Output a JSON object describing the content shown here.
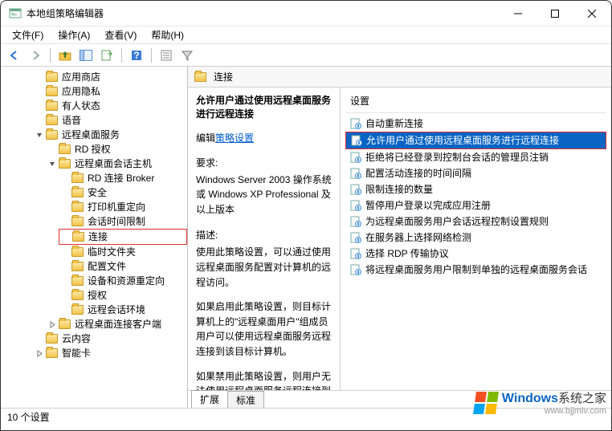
{
  "window": {
    "title": "本地组策略编辑器"
  },
  "menu": {
    "file": "文件(F)",
    "action": "操作(A)",
    "view": "查看(V)",
    "help": "帮助(H)"
  },
  "tree": {
    "items": [
      {
        "label": "应用商店",
        "twisty": ""
      },
      {
        "label": "应用隐私",
        "twisty": ""
      },
      {
        "label": "有人状态",
        "twisty": ""
      },
      {
        "label": "语音",
        "twisty": ""
      },
      {
        "label": "远程桌面服务",
        "twisty": "open",
        "children": [
          {
            "label": "RD 授权",
            "twisty": ""
          },
          {
            "label": "远程桌面会话主机",
            "twisty": "open",
            "children": [
              {
                "label": "RD 连接 Broker"
              },
              {
                "label": "安全"
              },
              {
                "label": "打印机重定向"
              },
              {
                "label": "会话时间限制"
              },
              {
                "label": "连接",
                "highlighted": true
              },
              {
                "label": "临时文件夹"
              },
              {
                "label": "配置文件"
              },
              {
                "label": "设备和资源重定向"
              },
              {
                "label": "授权"
              },
              {
                "label": "远程会话环境"
              }
            ]
          },
          {
            "label": "远程桌面连接客户端",
            "twisty": "closed"
          }
        ]
      },
      {
        "label": "云内容",
        "twisty": ""
      },
      {
        "label": "智能卡",
        "twisty": "closed"
      }
    ]
  },
  "details": {
    "header": "连接",
    "heading": "允许用户通过使用远程桌面服务进行远程连接",
    "edit_label": "编辑",
    "edit_link": "策略设置",
    "req_label": "要求:",
    "req_text": "Windows Server 2003 操作系统或 Windows XP Professional 及以上版本",
    "desc_label": "描述:",
    "desc1": "使用此策略设置，可以通过使用远程桌面服务配置对计算机的远程访问。",
    "desc2": "如果启用此策略设置，则目标计算机上的\"远程桌面用户\"组成员用户可以使用远程桌面服务远程连接到该目标计算机。",
    "desc3": "如果禁用此策略设置，则用户无法使用远程桌面服务远程连接到目"
  },
  "settings": {
    "column_header": "设置",
    "items": [
      {
        "label": "自动重新连接"
      },
      {
        "label": "允许用户通过使用远程桌面服务进行远程连接",
        "selected": true,
        "highlighted": true
      },
      {
        "label": "拒绝将已经登录到控制台会话的管理员注销"
      },
      {
        "label": "配置活动连接的时间间隔"
      },
      {
        "label": "限制连接的数量"
      },
      {
        "label": "暂停用户登录以完成应用注册"
      },
      {
        "label": "为远程桌面服务用户会话远程控制设置规则"
      },
      {
        "label": "在服务器上选择网络检测"
      },
      {
        "label": "选择 RDP 传输协议"
      },
      {
        "label": "将远程桌面服务用户限制到单独的远程桌面服务会话"
      }
    ]
  },
  "tabs": {
    "extended": "扩展",
    "standard": "标准"
  },
  "status": {
    "text": "10 个设置"
  },
  "watermark": {
    "brand": "Windows",
    "sub": "系统之家",
    "url": "www.bjjmlv.com"
  }
}
